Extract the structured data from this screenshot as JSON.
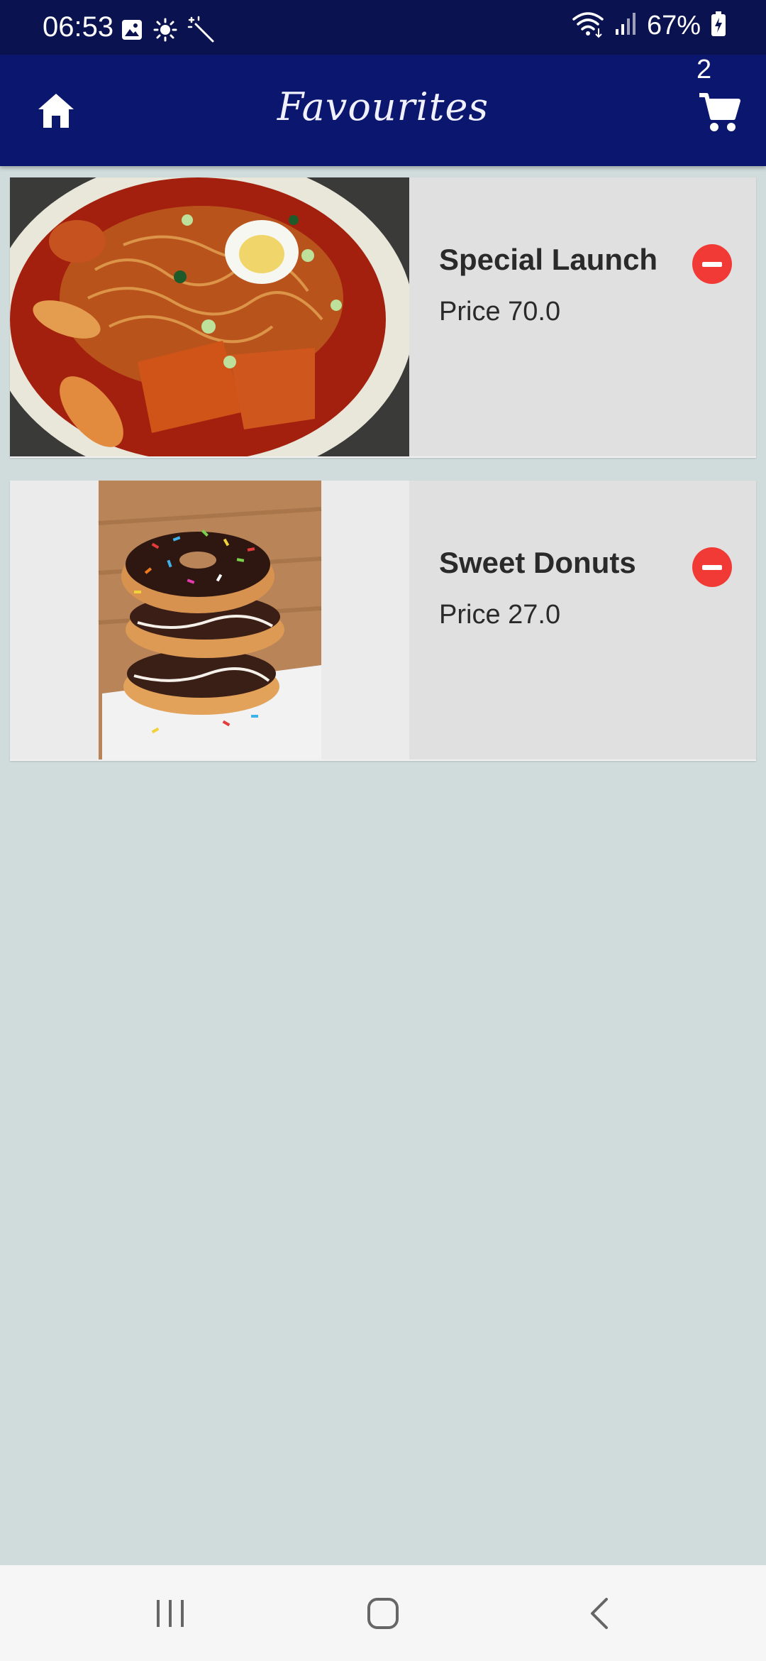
{
  "status_bar": {
    "time": "06:53",
    "battery_percent": "67%",
    "icons_left": [
      "gallery-icon",
      "brightness-icon",
      "magic-wand-icon"
    ],
    "icons_right": [
      "wifi-icon",
      "signal-icon",
      "battery-charging-icon"
    ]
  },
  "app_bar": {
    "title": "Favourites",
    "cart_count": "2",
    "home_icon": "home-icon",
    "cart_icon": "shopping-cart-icon",
    "background_color": "#0b176f"
  },
  "favourites": [
    {
      "title": "Special Launch",
      "price": "Price 70.0",
      "image": "tteokbokki-ramen-photo",
      "remove_icon": "remove-circle-icon"
    },
    {
      "title": "Sweet Donuts",
      "price": "Price 27.0",
      "image": "stacked-donuts-photo",
      "remove_icon": "remove-circle-icon"
    }
  ],
  "nav_bar": {
    "icons": [
      "recent-apps-icon",
      "home-button-icon",
      "back-icon"
    ]
  },
  "colors": {
    "background": "#d0dcdc",
    "card": "#e0e0e0",
    "remove_button": "#f13a35",
    "status_bar": "#0a124f"
  }
}
